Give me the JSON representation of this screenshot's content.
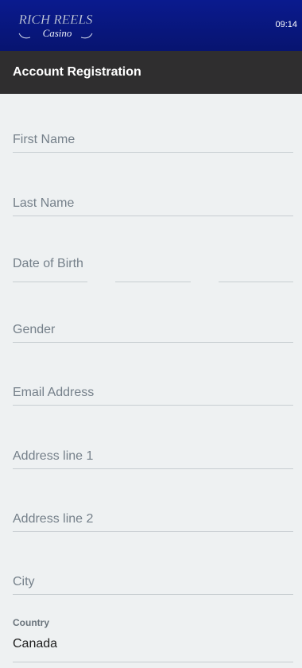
{
  "header": {
    "logo_alt": "Rich Reels Casino",
    "logo_line1": "RICH REELS",
    "logo_line2": "Casino",
    "time": "09:14"
  },
  "page": {
    "title": "Account Registration"
  },
  "form": {
    "first_name": {
      "placeholder": "First Name"
    },
    "last_name": {
      "placeholder": "Last Name"
    },
    "date_of_birth": {
      "placeholder": "Date of Birth"
    },
    "gender": {
      "placeholder": "Gender"
    },
    "email": {
      "placeholder": "Email Address"
    },
    "address_line1": {
      "placeholder": "Address line 1"
    },
    "address_line2": {
      "placeholder": "Address line 2"
    },
    "city": {
      "placeholder": "City"
    },
    "country": {
      "label": "Country",
      "value": "Canada"
    }
  },
  "colors": {
    "topbar": "#0a1a8e",
    "titlebar": "#2f2e2f",
    "background": "#eef1f2",
    "placeholder": "#75808a",
    "divider": "#c7cdd1"
  }
}
